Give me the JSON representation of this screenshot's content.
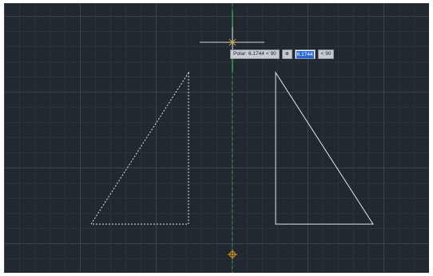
{
  "colors": {
    "canvas_bg": "#212830",
    "grid_major": "#3c4452",
    "grid_minor": "#2b323c",
    "polar_tracking": "#2f8a3a",
    "crosshair": "#cfd3d8",
    "snap_marker": "#d9a21b",
    "geometry": "#e6e6e6"
  },
  "tooltip": {
    "label": "Polar:",
    "distance": "6.1744",
    "angle": "< 90",
    "input_value": "6.1744",
    "input_angle": "< 90",
    "lock_icon": "lock-icon"
  },
  "drawing": {
    "left_triangle": {
      "style": "dashed",
      "state": "preview"
    },
    "right_triangle": {
      "style": "solid",
      "state": "original"
    }
  }
}
